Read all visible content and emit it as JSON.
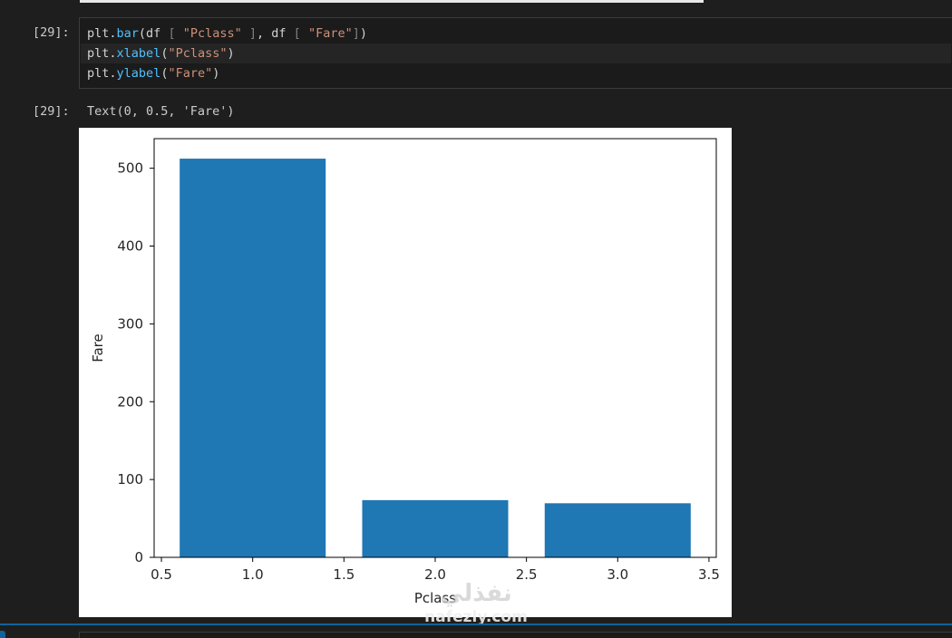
{
  "notebook": {
    "input_prompt": "[29]:",
    "output_prompt": "[29]:",
    "code_lines": [
      {
        "tokens": [
          {
            "t": "plt",
            "c": "var"
          },
          {
            "t": ".",
            "c": "punc"
          },
          {
            "t": "bar",
            "c": "fn"
          },
          {
            "t": "(df ",
            "c": "var"
          },
          {
            "t": "[",
            "c": "bracket"
          },
          {
            "t": " ",
            "c": "var"
          },
          {
            "t": "\"Pclass\"",
            "c": "str"
          },
          {
            "t": " ",
            "c": "var"
          },
          {
            "t": "]",
            "c": "bracket"
          },
          {
            "t": ", df ",
            "c": "var"
          },
          {
            "t": "[",
            "c": "bracket"
          },
          {
            "t": " ",
            "c": "var"
          },
          {
            "t": "\"Fare\"",
            "c": "str"
          },
          {
            "t": "]",
            "c": "bracket"
          },
          {
            "t": ")",
            "c": "var"
          }
        ]
      },
      {
        "tokens": [
          {
            "t": "plt",
            "c": "var"
          },
          {
            "t": ".",
            "c": "punc"
          },
          {
            "t": "xlabel",
            "c": "fn"
          },
          {
            "t": "(",
            "c": "var"
          },
          {
            "t": "\"Pclass\"",
            "c": "str"
          },
          {
            "t": ")",
            "c": "var"
          }
        ]
      },
      {
        "tokens": [
          {
            "t": "plt",
            "c": "var"
          },
          {
            "t": ".",
            "c": "punc"
          },
          {
            "t": "ylabel",
            "c": "fn"
          },
          {
            "t": "(",
            "c": "var"
          },
          {
            "t": "\"Fare\"",
            "c": "str"
          },
          {
            "t": ")",
            "c": "var"
          }
        ]
      }
    ],
    "output_text": "Text(0, 0.5, 'Fare')",
    "watermark": {
      "arabic": "نفذلي",
      "latin": "nafezly.com"
    }
  },
  "colors": {
    "bar": "#1f77b4",
    "string": "#ce9178",
    "function": "#4fc1ff",
    "focus": "#0e639c"
  },
  "chart_data": {
    "type": "bar",
    "x": [
      1.0,
      2.0,
      3.0
    ],
    "values": [
      512.3,
      73.5,
      69.5
    ],
    "bar_width": 0.8,
    "xlabel": "Pclass",
    "ylabel": "Fare",
    "xlim": [
      0.46,
      3.54
    ],
    "ylim": [
      0,
      538
    ],
    "xticks": [
      0.5,
      1.0,
      1.5,
      2.0,
      2.5,
      3.0,
      3.5
    ],
    "xtick_labels": [
      "0.5",
      "1.0",
      "1.5",
      "2.0",
      "2.5",
      "3.0",
      "3.5"
    ],
    "yticks": [
      0,
      100,
      200,
      300,
      400,
      500
    ],
    "ytick_labels": [
      "0",
      "100",
      "200",
      "300",
      "400",
      "500"
    ],
    "grid": false,
    "legend": false
  }
}
